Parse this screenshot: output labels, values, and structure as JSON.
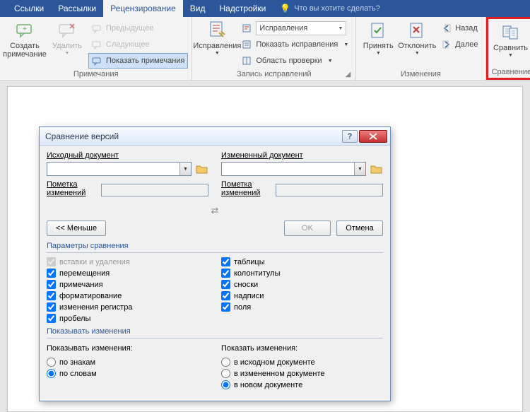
{
  "tabs": {
    "links": "Ссылки",
    "mailings": "Рассылки",
    "review": "Рецензирование",
    "view": "Вид",
    "addins": "Надстройки",
    "tell_me": "Что вы хотите сделать?"
  },
  "ribbon": {
    "comments": {
      "new": "Создать примечание",
      "delete": "Удалить",
      "prev": "Предыдущее",
      "next": "Следующее",
      "show": "Показать примечания",
      "group": "Примечания"
    },
    "tracking": {
      "btn": "Исправления",
      "markup_dd": "Исправления",
      "show_markup": "Показать исправления",
      "reviewing_pane": "Область проверки",
      "group": "Запись исправлений"
    },
    "changes": {
      "accept": "Принять",
      "reject": "Отклонить",
      "back": "Назад",
      "forward": "Далее",
      "group": "Изменения"
    },
    "compare": {
      "btn": "Сравнить",
      "group": "Сравнение"
    }
  },
  "dialog": {
    "title": "Сравнение версий",
    "original": {
      "label": "Исходный документ",
      "mark": "Пометка изменений"
    },
    "revised": {
      "label": "Измененный документ",
      "mark": "Пометка изменений"
    },
    "buttons": {
      "less": "<< Меньше",
      "ok": "OK",
      "cancel": "Отмена"
    },
    "opts_title": "Параметры сравнения",
    "opts": {
      "insertions": "вставки и удаления",
      "moves": "перемещения",
      "comments": "примечания",
      "formatting": "форматирование",
      "case": "изменения регистра",
      "whitespace": "пробелы",
      "tables": "таблицы",
      "headers": "колонтитулы",
      "footnotes": "сноски",
      "textboxes": "надписи",
      "fields": "поля"
    },
    "show_title": "Показывать изменения",
    "show_left_title": "Показывать изменения:",
    "show_right_title": "Показать изменения:",
    "granularity": {
      "char": "по знакам",
      "word": "по словам"
    },
    "location": {
      "original": "в исходном документе",
      "revised": "в измененном документе",
      "new": "в новом документе"
    }
  }
}
